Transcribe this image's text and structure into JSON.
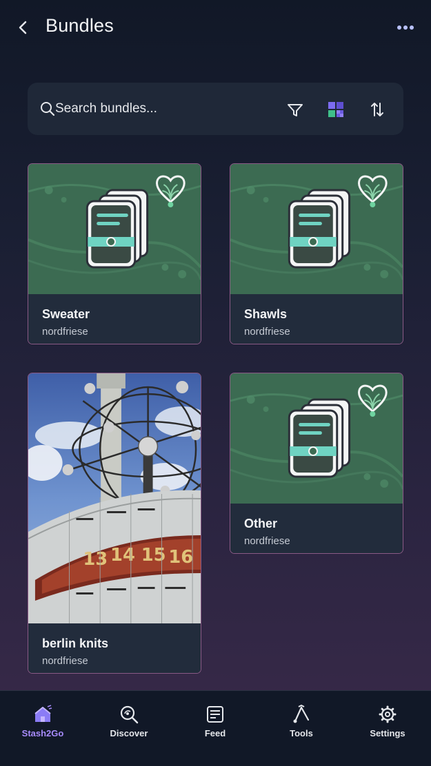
{
  "header": {
    "title": "Bundles"
  },
  "search": {
    "placeholder": "Search bundles..."
  },
  "bundles": [
    {
      "title": "Sweater",
      "owner": "nordfriese",
      "thumbnail": "placeholder-icon"
    },
    {
      "title": "Shawls",
      "owner": "nordfriese",
      "thumbnail": "placeholder-icon"
    },
    {
      "title": "berlin knits",
      "owner": "nordfriese",
      "thumbnail": "photo-world-clock"
    },
    {
      "title": "Other",
      "owner": "nordfriese",
      "thumbnail": "placeholder-icon"
    }
  ],
  "nav": {
    "items": [
      {
        "label": "Stash2Go",
        "icon": "house-icon",
        "active": true
      },
      {
        "label": "Discover",
        "icon": "discover-icon",
        "active": false
      },
      {
        "label": "Feed",
        "icon": "feed-icon",
        "active": false
      },
      {
        "label": "Tools",
        "icon": "tools-icon",
        "active": false
      },
      {
        "label": "Settings",
        "icon": "gear-icon",
        "active": false
      }
    ]
  },
  "colors": {
    "accent": "#a78bfa",
    "card_green": "#3c6b52",
    "card_border": "#8a5a86",
    "card_info_bg": "#222c3c",
    "search_bg": "#1f2838"
  }
}
